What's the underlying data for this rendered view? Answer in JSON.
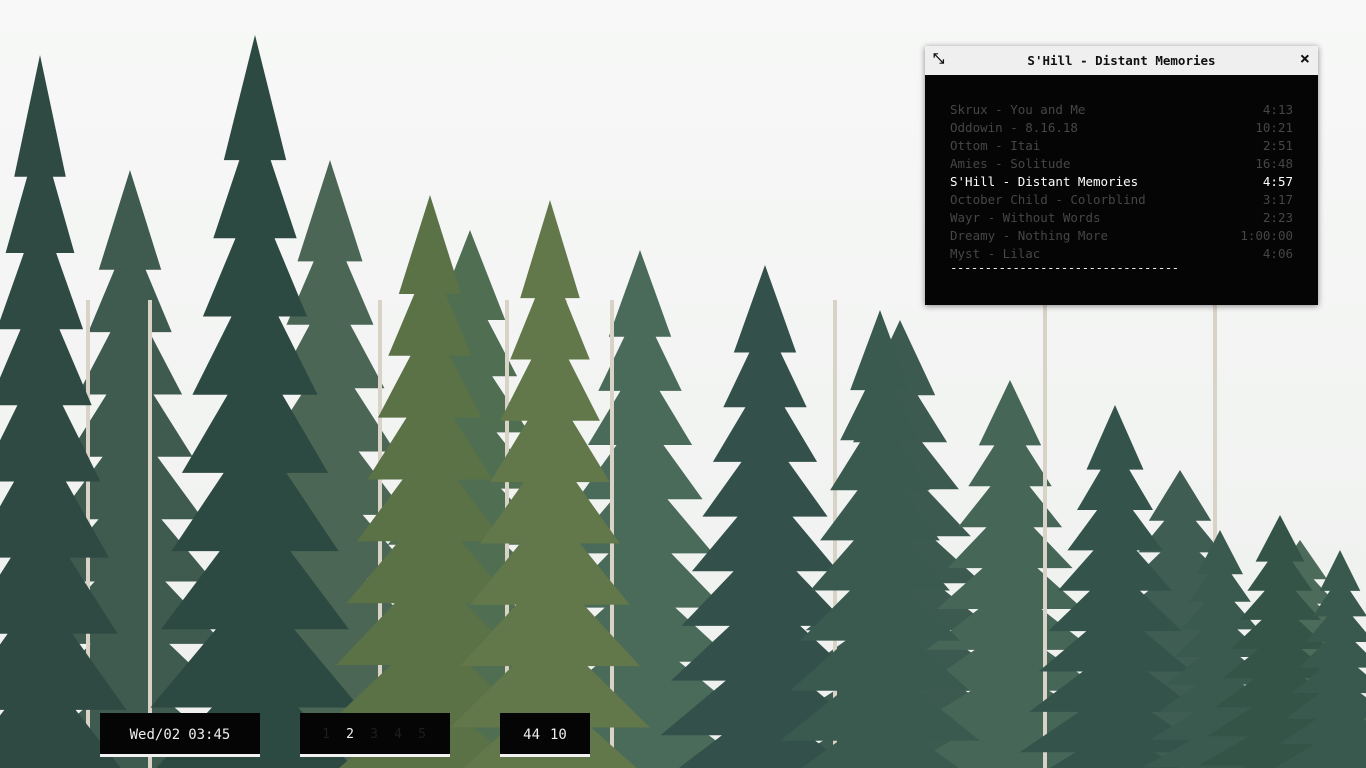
{
  "player": {
    "title": "S'Hill - Distant Memories",
    "resize_glyph": "⤡",
    "close_glyph": "×",
    "tracks": [
      {
        "name": "Skrux - You and Me",
        "duration": "4:13"
      },
      {
        "name": "Oddowin - 8.16.18",
        "duration": "10:21"
      },
      {
        "name": "Ottom - Itai",
        "duration": "2:51"
      },
      {
        "name": "Amies - Solitude",
        "duration": "16:48"
      },
      {
        "name": "S'Hill - Distant Memories",
        "duration": "4:57"
      },
      {
        "name": "October Child - Colorblind",
        "duration": "3:17"
      },
      {
        "name": "Wayr - Without Words",
        "duration": "2:23"
      },
      {
        "name": "Dreamy - Nothing More",
        "duration": "1:00:00"
      },
      {
        "name": "Myst - Lilac",
        "duration": "4:06"
      }
    ],
    "playing_index": 4,
    "separator": "---------------------------------",
    "colors": {
      "playing": "#ffffff",
      "idle": "#464646",
      "window_bg": "#050505",
      "titlebar_bg": "#efefef"
    }
  },
  "bar": {
    "day": "Wed/02",
    "time": "03:45",
    "workspaces": [
      {
        "label": "1",
        "active": false
      },
      {
        "label": "2",
        "active": true
      },
      {
        "label": "3",
        "active": false
      },
      {
        "label": "4",
        "active": false
      },
      {
        "label": "5",
        "active": false
      }
    ],
    "stat_a": "44",
    "stat_b": "10"
  }
}
